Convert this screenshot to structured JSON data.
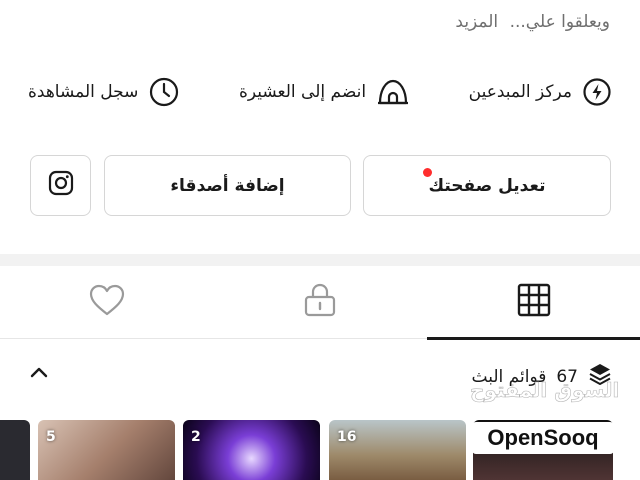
{
  "profile": {
    "bio_line": "ويعلقوا علي...",
    "bio_more": "المزيد"
  },
  "quick_links": [
    {
      "label": "مركز المبدعين",
      "icon": "creator-center-icon"
    },
    {
      "label": "انضم إلى العشيرة",
      "icon": "clan-icon"
    },
    {
      "label": "سجل المشاهدة",
      "icon": "watch-history-icon"
    }
  ],
  "actions": {
    "edit_label": "تعديل صفحتك",
    "add_friends_label": "إضافة أصدقاء",
    "instagram_icon": "instagram-icon",
    "notify_color": "#ff2d2d"
  },
  "tabs": [
    {
      "name": "videos",
      "icon": "grid-icon",
      "active": true
    },
    {
      "name": "private",
      "icon": "lock-icon",
      "active": false
    },
    {
      "name": "liked",
      "icon": "heart-icon",
      "active": false
    }
  ],
  "playlists": {
    "count": "67",
    "label": "قوائم البث",
    "icon": "stack-icon",
    "collapse_icon": "chevron-up-icon"
  },
  "thumbnails": [
    {
      "count": ""
    },
    {
      "count": "5"
    },
    {
      "count": "2"
    },
    {
      "count": "16"
    },
    {
      "count": ""
    }
  ],
  "watermark": {
    "arabic": "السوق المفتوح",
    "brand": "OpenSooq"
  }
}
